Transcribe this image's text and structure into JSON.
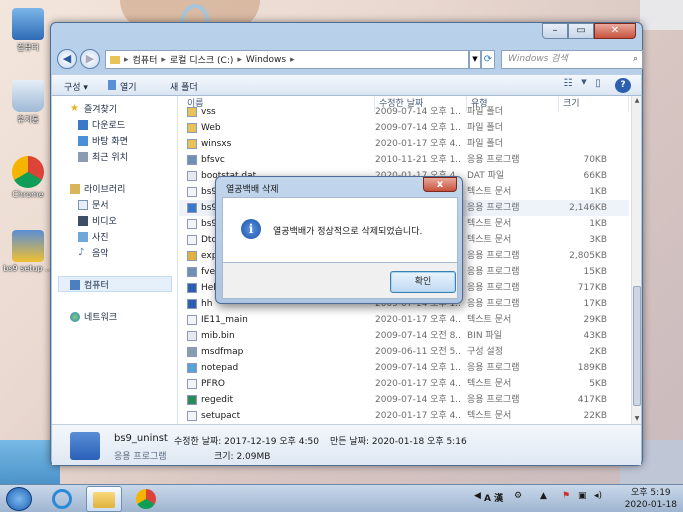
{
  "desktop": {
    "icons": [
      {
        "label": "컴퓨터",
        "icon": "computer-icon"
      },
      {
        "label": "휴지통",
        "icon": "recycle-bin-icon"
      },
      {
        "label": "Chrome",
        "icon": "chrome-icon"
      },
      {
        "label": "bs9 setup ...",
        "icon": "setup-icon"
      }
    ]
  },
  "window": {
    "address": {
      "segments": [
        "컴퓨터",
        "로컬 디스크 (C:)",
        "Windows"
      ]
    },
    "search_placeholder": "Windows 검색",
    "toolbar": {
      "organize": "구성 ▾",
      "open": "열기",
      "new_folder": "새 폴더"
    },
    "nav": [
      {
        "label": "즐겨찾기",
        "icon": "star-icon"
      },
      {
        "label": "다운로드",
        "icon": "download-folder-icon"
      },
      {
        "label": "바탕 화면",
        "icon": "desktop-folder-icon"
      },
      {
        "label": "최근 위치",
        "icon": "recent-places-icon"
      },
      {
        "label": "라이브러리",
        "icon": "library-icon"
      },
      {
        "label": "문서",
        "icon": "documents-icon"
      },
      {
        "label": "비디오",
        "icon": "video-icon"
      },
      {
        "label": "사진",
        "icon": "pictures-icon"
      },
      {
        "label": "음악",
        "icon": "music-icon"
      },
      {
        "label": "컴퓨터",
        "icon": "computer-icon"
      },
      {
        "label": "네트워크",
        "icon": "network-icon"
      }
    ],
    "columns": {
      "name": "이름",
      "date": "수정한 날짜",
      "type": "유형",
      "size": "크기"
    },
    "files": [
      {
        "name": "vss",
        "date": "2009-07-14 오후 1...",
        "type": "파일 폴더",
        "size": "",
        "icon": "folder-icon"
      },
      {
        "name": "Web",
        "date": "2009-07-14 오후 1...",
        "type": "파일 폴더",
        "size": "",
        "icon": "folder-icon"
      },
      {
        "name": "winsxs",
        "date": "2020-01-17 오후 4...",
        "type": "파일 폴더",
        "size": "",
        "icon": "folder-icon"
      },
      {
        "name": "bfsvc",
        "date": "2010-11-21 오후 1...",
        "type": "응용 프로그램",
        "size": "70KB",
        "icon": "exe-icon"
      },
      {
        "name": "bootstat.dat",
        "date": "2020-01-17 오후 4...",
        "type": "DAT 파일",
        "size": "66KB",
        "icon": "file-icon"
      },
      {
        "name": "bs9",
        "date": "2020-01-17 오후 4...",
        "type": "텍스트 문서",
        "size": "1KB",
        "icon": "text-icon"
      },
      {
        "name": "bs9_uninst",
        "date": "2017-12-19 오후 4...",
        "type": "응용 프로그램",
        "size": "2,146KB",
        "icon": "setup-icon"
      },
      {
        "name": "bs9",
        "date": "2020-01-17 오후 4...",
        "type": "텍스트 문서",
        "size": "1KB",
        "icon": "text-icon"
      },
      {
        "name": "DtcInstall",
        "date": "2020-01-17 오후 4...",
        "type": "텍스트 문서",
        "size": "3KB",
        "icon": "text-icon"
      },
      {
        "name": "explorer",
        "date": "2009-07-14 오후 1...",
        "type": "응용 프로그램",
        "size": "2,805KB",
        "icon": "explorer-icon"
      },
      {
        "name": "fveupdate",
        "date": "2009-07-14 오후 1...",
        "type": "응용 프로그램",
        "size": "15KB",
        "icon": "exe-icon"
      },
      {
        "name": "HelpPane",
        "date": "2009-07-14 오후 1...",
        "type": "응용 프로그램",
        "size": "717KB",
        "icon": "help-icon"
      },
      {
        "name": "hh",
        "date": "2009-07-14 오후 1...",
        "type": "응용 프로그램",
        "size": "17KB",
        "icon": "help-icon"
      },
      {
        "name": "IE11_main",
        "date": "2020-01-17 오후 4...",
        "type": "텍스트 문서",
        "size": "29KB",
        "icon": "text-icon"
      },
      {
        "name": "mib.bin",
        "date": "2009-07-14 오전 8...",
        "type": "BIN 파일",
        "size": "43KB",
        "icon": "file-icon"
      },
      {
        "name": "msdfmap",
        "date": "2009-06-11 오전 5...",
        "type": "구성 설정",
        "size": "2KB",
        "icon": "config-icon"
      },
      {
        "name": "notepad",
        "date": "2009-07-14 오후 1...",
        "type": "응용 프로그램",
        "size": "189KB",
        "icon": "notepad-icon"
      },
      {
        "name": "PFRO",
        "date": "2020-01-17 오후 4...",
        "type": "텍스트 문서",
        "size": "5KB",
        "icon": "text-icon"
      },
      {
        "name": "regedit",
        "date": "2009-07-14 오후 1...",
        "type": "응용 프로그램",
        "size": "417KB",
        "icon": "regedit-icon"
      },
      {
        "name": "setupact",
        "date": "2020-01-17 오후 4...",
        "type": "텍스트 문서",
        "size": "22KB",
        "icon": "text-icon"
      }
    ],
    "details": {
      "name": "bs9_uninst",
      "type": "응용 프로그램",
      "modified": "수정한 날짜: 2017-12-19 오후 4:50",
      "created": "만든 날짜: 2020-01-18 오후 5:16",
      "size": "크기: 2.09MB"
    }
  },
  "dialog": {
    "title": "열공백배 삭제",
    "message": "열공백배가 정상적으로 삭제되었습니다.",
    "ok": "확인",
    "close": "x"
  },
  "taskbar": {
    "tray_text": "A 漢",
    "time": "오후 5:19",
    "date": "2020-01-18"
  },
  "colors": {
    "accent": "#2c5fb0",
    "selection": "#e5f0fb"
  }
}
